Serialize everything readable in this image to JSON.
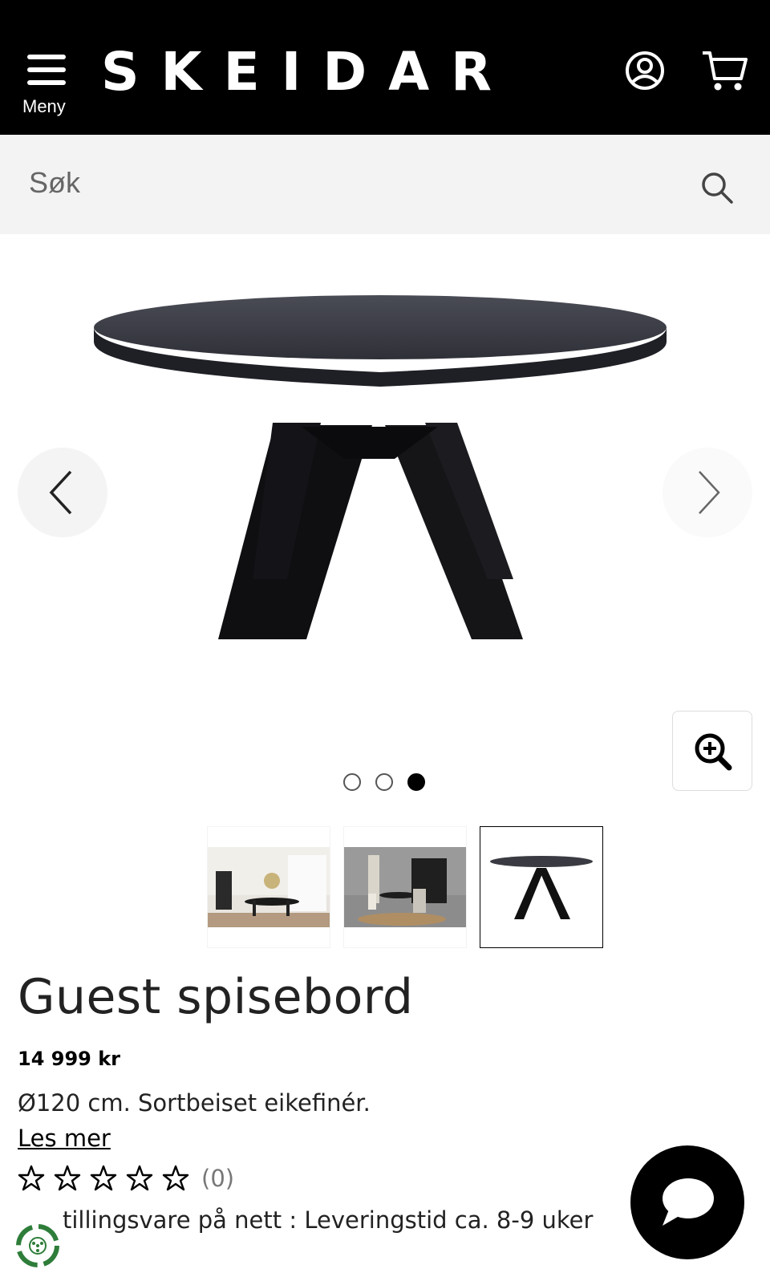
{
  "header": {
    "logo": "SKEIDAR",
    "menu_label": "Meny",
    "icons": [
      "menu-icon",
      "account-icon",
      "cart-icon"
    ]
  },
  "search": {
    "placeholder": "Søk",
    "icon": "search-icon"
  },
  "gallery": {
    "image_count": 3,
    "active_index": 3,
    "thumbnails": [
      "thumbnail-dining-room-1",
      "thumbnail-dining-room-2",
      "thumbnail-table"
    ]
  },
  "product": {
    "title": "Guest spisebord",
    "price": "14 999 kr",
    "description": "Ø120 cm. Sortbeiset eikefinér.",
    "read_more": "Les mer",
    "rating_stars": 0,
    "rating_max": 5,
    "rating_count": "(0)",
    "delivery": "tillingsvare på nett : Leveringstid ca. 8-9 uker"
  },
  "colors": {
    "header_bg": "#000000",
    "search_bg": "#f3f3f3",
    "text": "#222222"
  }
}
